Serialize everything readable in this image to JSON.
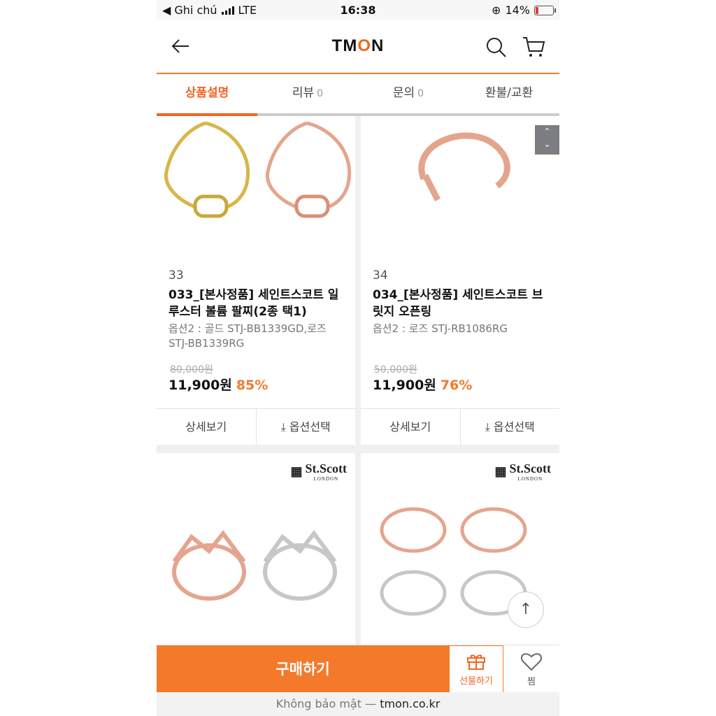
{
  "status": {
    "carrier": "◀ Ghi chú",
    "network": "LTE",
    "time": "16:38",
    "battery": "14%"
  },
  "header": {
    "logo_pre": "TM",
    "logo_o": "O",
    "logo_post": "N"
  },
  "tabs": [
    {
      "label": "상품설명",
      "count": ""
    },
    {
      "label": "리뷰",
      "count": "0"
    },
    {
      "label": "문의",
      "count": "0"
    },
    {
      "label": "환불/교환",
      "count": ""
    }
  ],
  "products": [
    {
      "num": "33",
      "title": "033_[본사정품] 세인트스코트 일루스터 볼륨 팔찌(2종 택1)",
      "option": "옵션2 : 골드 STJ-BB1339GD,로즈 STJ-BB1339RG",
      "original_price": "80,000원",
      "price": "11,900원",
      "discount": "85%",
      "detail": "상세보기",
      "select": "옵션선택"
    },
    {
      "num": "34",
      "title": "034_[본사정품] 세인트스코트 브릿지 오픈링",
      "option": "옵션2 : 로즈 STJ-RB1086RG",
      "original_price": "50,000원",
      "price": "11,900원",
      "discount": "76%",
      "detail": "상세보기",
      "select": "옵션선택"
    }
  ],
  "brand": {
    "name": "St.Scott",
    "sub": "LONDON"
  },
  "bottom": {
    "buy": "구매하기",
    "gift": "선물하기",
    "wish": "찜"
  },
  "url": {
    "prefix": "Không bảo mật —",
    "domain": "tmon.co.kr"
  },
  "colors": {
    "accent": "#f47a2b"
  }
}
